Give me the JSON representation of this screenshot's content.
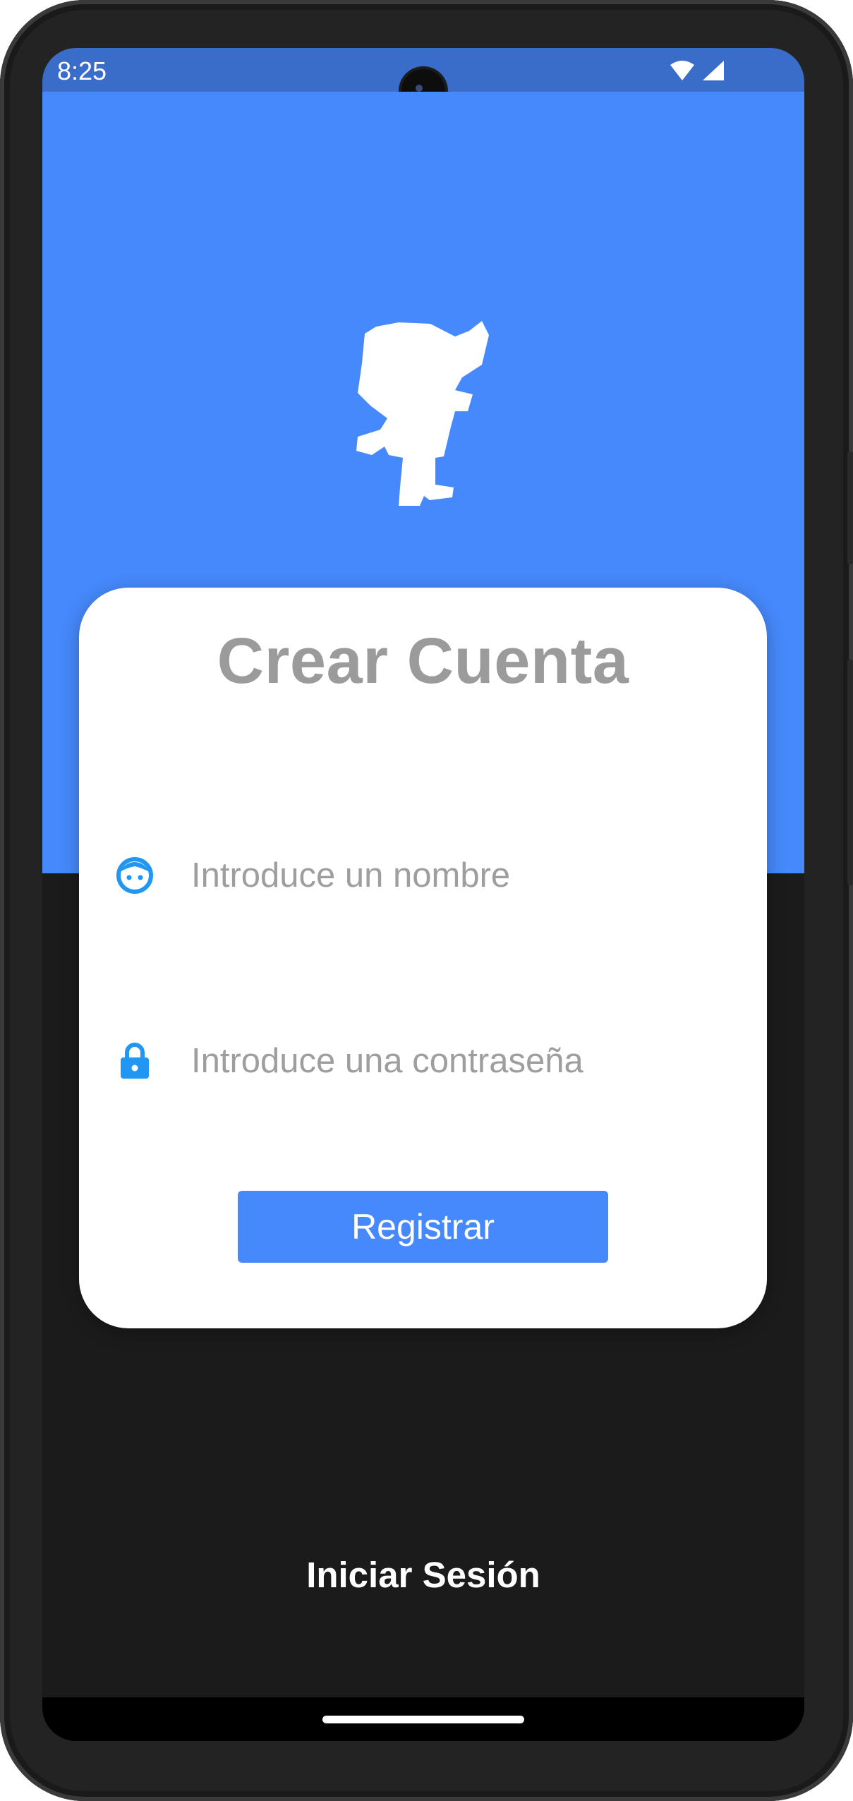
{
  "status_bar": {
    "time": "8:25",
    "icons": [
      "wifi-icon",
      "cellular-signal-icon"
    ],
    "background": "#3a6cc9"
  },
  "hero": {
    "background": "#4689fc",
    "logo": "mascot-silhouette-icon"
  },
  "form": {
    "title": "Crear Cuenta",
    "name_field": {
      "icon": "face-icon",
      "placeholder": "Introduce un nombre",
      "value": ""
    },
    "password_field": {
      "icon": "lock-icon",
      "placeholder": "Introduce una contraseña",
      "value": ""
    },
    "submit_label": "Registrar"
  },
  "footer": {
    "login_label": "Iniciar Sesión"
  },
  "colors": {
    "accent": "#4689fc",
    "icon_blue": "#2196f3",
    "title_gray": "#9b9b9b",
    "screen_background": "#1b1b1b"
  }
}
